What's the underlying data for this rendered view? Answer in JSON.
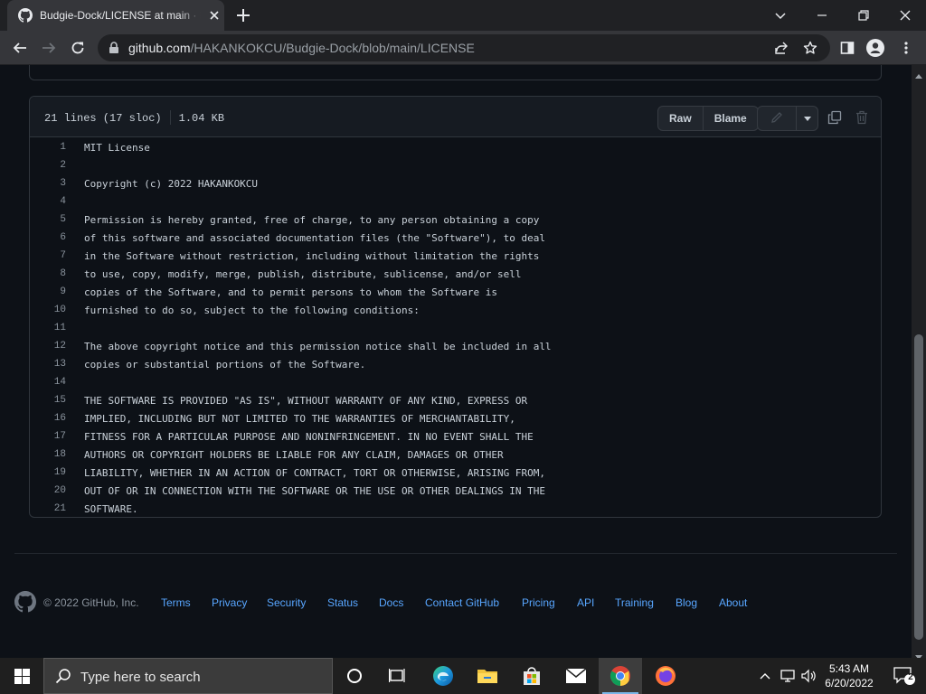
{
  "browser": {
    "tab_title": "Budgie-Dock/LICENSE at main · HAKANKOKCU/Budgie-Dock",
    "url_host": "github.com",
    "url_path": "/HAKANKOKCU/Budgie-Dock/blob/main/LICENSE"
  },
  "file": {
    "lines_info": "21 lines (17 sloc)",
    "size": "1.04 KB",
    "raw_label": "Raw",
    "blame_label": "Blame",
    "lines": [
      "MIT License",
      "",
      "Copyright (c) 2022 HAKANKOKCU",
      "",
      "Permission is hereby granted, free of charge, to any person obtaining a copy",
      "of this software and associated documentation files (the \"Software\"), to deal",
      "in the Software without restriction, including without limitation the rights",
      "to use, copy, modify, merge, publish, distribute, sublicense, and/or sell",
      "copies of the Software, and to permit persons to whom the Software is",
      "furnished to do so, subject to the following conditions:",
      "",
      "The above copyright notice and this permission notice shall be included in all",
      "copies or substantial portions of the Software.",
      "",
      "THE SOFTWARE IS PROVIDED \"AS IS\", WITHOUT WARRANTY OF ANY KIND, EXPRESS OR",
      "IMPLIED, INCLUDING BUT NOT LIMITED TO THE WARRANTIES OF MERCHANTABILITY,",
      "FITNESS FOR A PARTICULAR PURPOSE AND NONINFRINGEMENT. IN NO EVENT SHALL THE",
      "AUTHORS OR COPYRIGHT HOLDERS BE LIABLE FOR ANY CLAIM, DAMAGES OR OTHER",
      "LIABILITY, WHETHER IN AN ACTION OF CONTRACT, TORT OR OTHERWISE, ARISING FROM,",
      "OUT OF OR IN CONNECTION WITH THE SOFTWARE OR THE USE OR OTHER DEALINGS IN THE",
      "SOFTWARE."
    ]
  },
  "footer": {
    "copyright": "© 2022 GitHub, Inc.",
    "links": [
      "Terms",
      "Privacy",
      "Security",
      "Status",
      "Docs",
      "Contact GitHub",
      "Pricing",
      "API",
      "Training",
      "Blog",
      "About"
    ]
  },
  "taskbar": {
    "search_placeholder": "Type here to search",
    "time": "5:43 AM",
    "date": "6/20/2022",
    "notification_count": "2"
  },
  "icons": {
    "tab_favicon": "github-icon",
    "tab_close": "close-icon",
    "new_tab": "plus-icon",
    "back": "arrow-left-icon",
    "forward": "arrow-right-icon",
    "reload": "reload-icon",
    "lock": "lock-icon",
    "share": "share-icon",
    "bookmark": "star-icon",
    "side_panel": "side-panel-icon",
    "profile": "profile-icon",
    "menu": "more-vertical-icon",
    "edit": "pencil-icon",
    "more": "triangle-down-icon",
    "copy": "copy-icon",
    "delete": "trash-icon",
    "footer_logo": "github-icon",
    "windows_start": "windows-icon",
    "search": "search-icon",
    "task_view": "task-view-icon",
    "edge": "edge-icon",
    "file_explorer": "folder-icon",
    "store": "store-icon",
    "mail": "mail-icon",
    "chrome": "chrome-icon",
    "firefox": "firefox-icon"
  },
  "colors": {
    "page_bg": "#0d1117",
    "link": "#58a6ff",
    "text": "#c9d1d9",
    "muted": "#8b949e"
  }
}
